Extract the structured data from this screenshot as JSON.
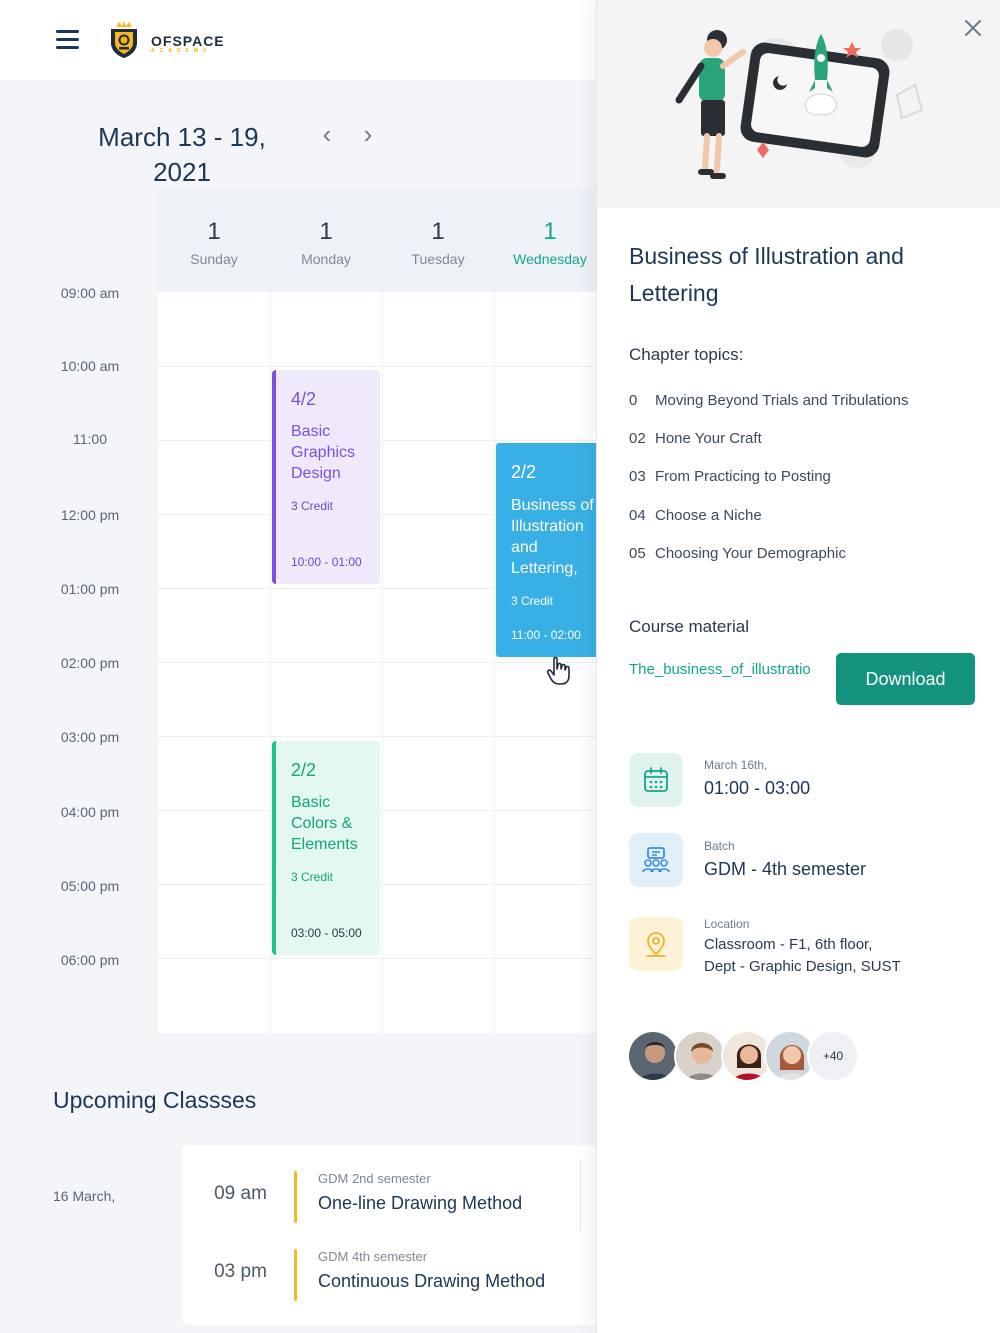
{
  "app": {
    "logo_text": "OFSPACE",
    "logo_sub": "ACADEMY"
  },
  "calendar": {
    "date_range": "March 13 - 19, 2021",
    "prev_label": "‹",
    "next_label": "›",
    "days": [
      {
        "num": "1",
        "name": "Sunday"
      },
      {
        "num": "1",
        "name": "Monday"
      },
      {
        "num": "1",
        "name": "Tuesday"
      },
      {
        "num": "1",
        "name": "Wednesday"
      }
    ],
    "times": [
      "09:00 am",
      "10:00 am",
      "11:00",
      "12:00 pm",
      "01:00 pm",
      "02:00 pm",
      "03:00 pm",
      "04:00 pm",
      "05:00 pm",
      "06:00 pm"
    ],
    "events": [
      {
        "num": "4/2",
        "title": "Basic Graphics Design",
        "credit": "3 Credit",
        "time": "10:00 - 01:00"
      },
      {
        "num": "2/2",
        "title": "Business of Illustration and Lettering,",
        "credit": "3 Credit",
        "time": "11:00 - 02:00"
      },
      {
        "num": "2/2",
        "title": "Basic Colors & Elements",
        "credit": "3 Credit",
        "time": "03:00 - 05:00"
      }
    ]
  },
  "upcoming": {
    "title": "Upcoming Classses",
    "date": "16 March,",
    "items": [
      {
        "time": "09 am",
        "batch": "GDM 2nd semester",
        "title": "One-line Drawing Method"
      },
      {
        "time": "03 pm",
        "batch": "GDM 4th semester",
        "title": "Continuous Drawing Method"
      }
    ]
  },
  "detail": {
    "title": "Business of Illustration and Lettering",
    "topics_heading": "Chapter topics:",
    "topics": [
      {
        "n": "0",
        "label": "Moving Beyond Trials and Tribulations"
      },
      {
        "n": "02",
        "label": "Hone Your Craft"
      },
      {
        "n": "03",
        "label": "From Practicing to Posting"
      },
      {
        "n": "04",
        "label": "Choose a Niche"
      },
      {
        "n": "05",
        "label": "Choosing Your Demographic"
      }
    ],
    "material_heading": "Course material",
    "file_name": "The_business_of_illustratio",
    "download_label": "Download",
    "date_small": "March 16th,",
    "date_big": "01:00 - 03:00",
    "batch_small": "Batch",
    "batch_big": "GDM - 4th semester",
    "location_small": "Location",
    "location_line1": "Classroom - F1, 6th floor,",
    "location_line2": "Dept - Graphic Design, SUST",
    "more_attendees": "+40"
  },
  "colors": {
    "accent_green": "#13937e",
    "event_purple": "#7b4fe0",
    "event_blue": "#39b0e5",
    "event_green": "#1fc38b",
    "highlight_yellow": "#f5b91e"
  }
}
